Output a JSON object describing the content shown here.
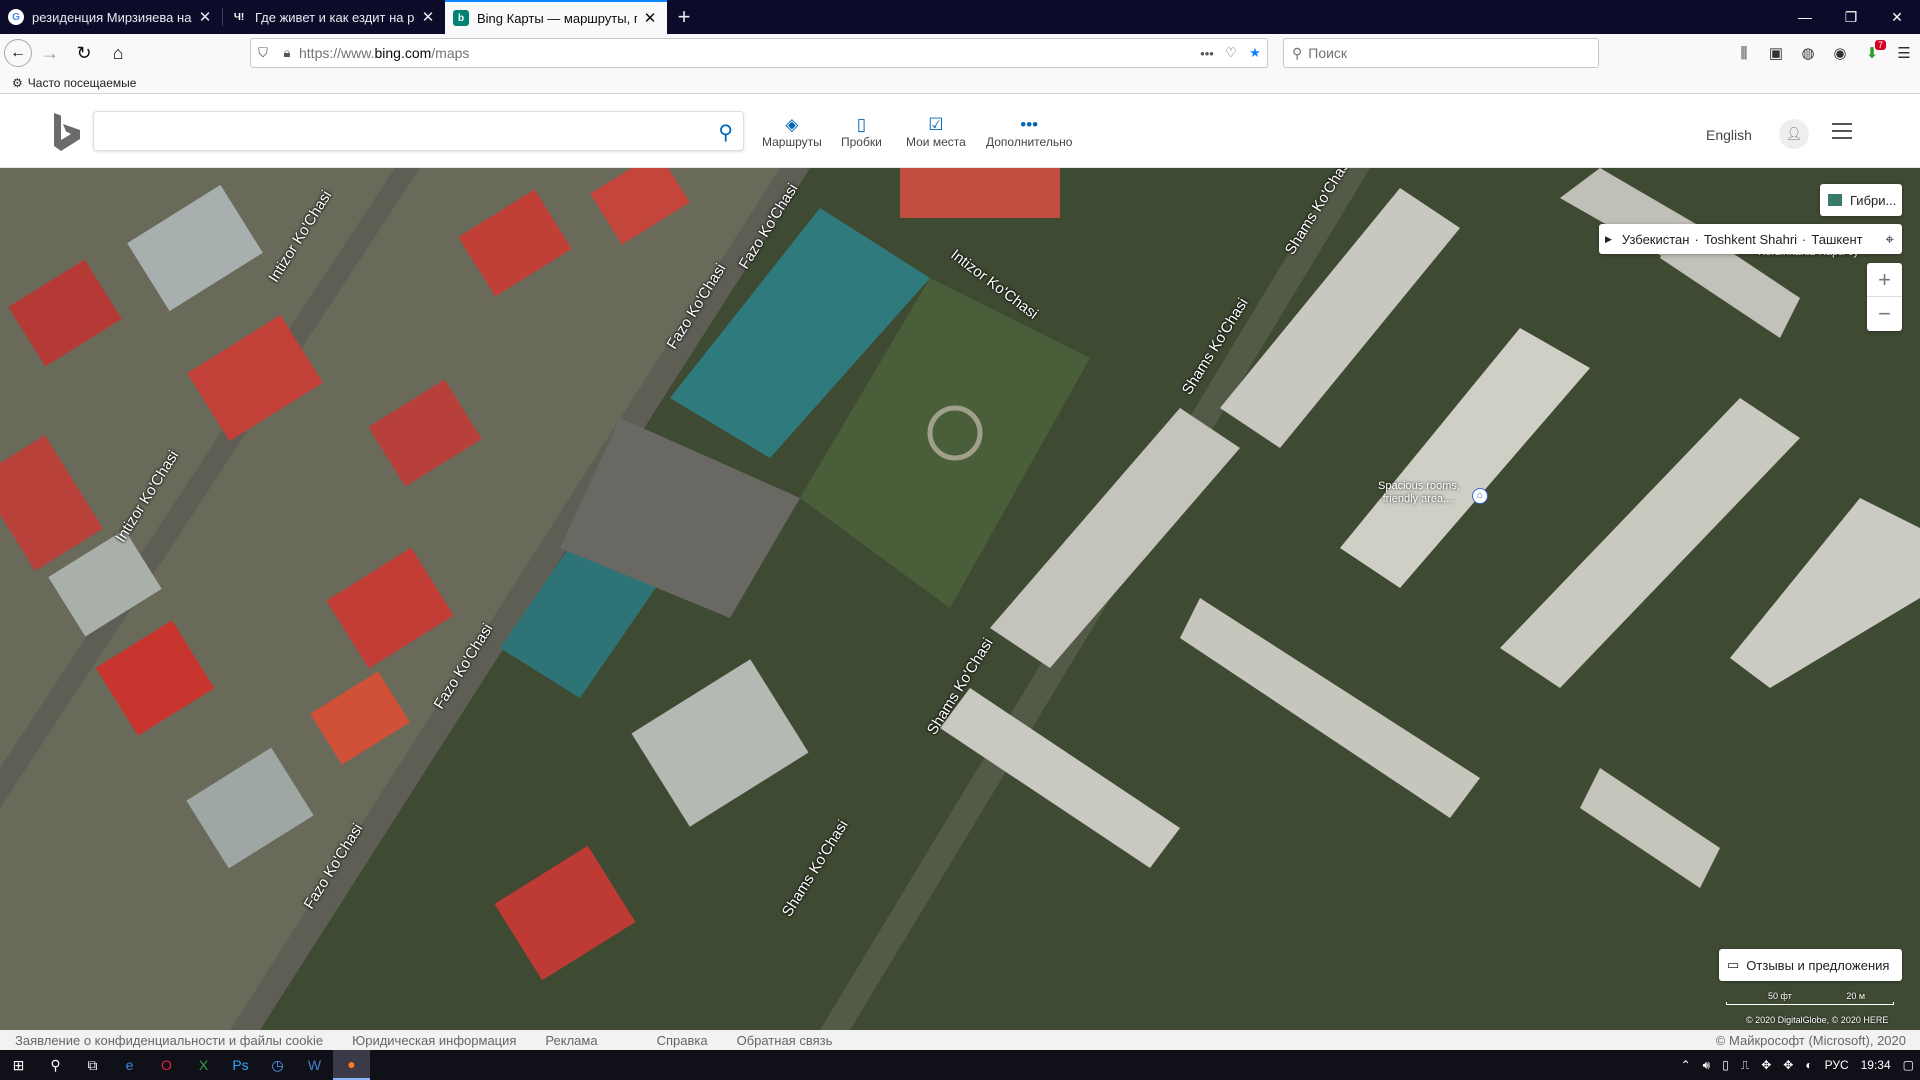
{
  "browser": {
    "tabs": [
      {
        "title": "резиденция Мирзияева на Ка",
        "active": false
      },
      {
        "title": "Где живет и как ездит на рабо",
        "active": false
      },
      {
        "title": "Bing Карты — маршруты, пла",
        "active": true
      }
    ],
    "new_tab": "+",
    "url_prefix": "https://www.",
    "url_domain": "bing.com",
    "url_path": "/maps",
    "search_placeholder": "Поиск",
    "bookmark_label": "Часто посещаемые",
    "notification_badge": "7"
  },
  "bing": {
    "search_value": "",
    "nav": [
      {
        "label": "Маршруты",
        "icon": "directions-icon"
      },
      {
        "label": "Пробки",
        "icon": "traffic-icon"
      },
      {
        "label": "Мои места",
        "icon": "my-places-icon"
      },
      {
        "label": "Дополнительно",
        "icon": "more-icon"
      }
    ],
    "language": "English"
  },
  "map": {
    "style_button": "Гибри...",
    "breadcrumb": [
      "Узбекистан",
      "Toshkent Shahri",
      "Ташкент"
    ],
    "feedback": "Отзывы и предложения",
    "scale_ft": "50 фт",
    "scale_m": "20 м",
    "imagery_credit": "© 2020 DigitalGlobe, © 2020 HERE",
    "labels": [
      "Intizor Ko'Chasi",
      "Fazo Ko'Chasi",
      "Fazo Ko'Chasi",
      "Intizor Ko'Chasi",
      "Intizor Ko'Chasi",
      "Fazo Ko'Chasi",
      "Fazo Ko'Chasi",
      "Shams Ko'Chasi",
      "Shams Ko'Chasi",
      "Shams Ko'Chasi",
      "Shams Ko'Chasi"
    ],
    "poi_korzinka": "Korzinka.uz Kapa-cy",
    "poi_hotel_line1": "Spacious rooms,",
    "poi_hotel_line2": "friendly area,..."
  },
  "footer": {
    "links": [
      "Заявление о конфиденциальности и файлы cookie",
      "Юридическая информация",
      "Реклама",
      "Справка",
      "Обратная связь"
    ],
    "copyright": "© Майкрософт (Microsoft), 2020"
  },
  "taskbar": {
    "lang": "РУС",
    "time": "19:34"
  }
}
